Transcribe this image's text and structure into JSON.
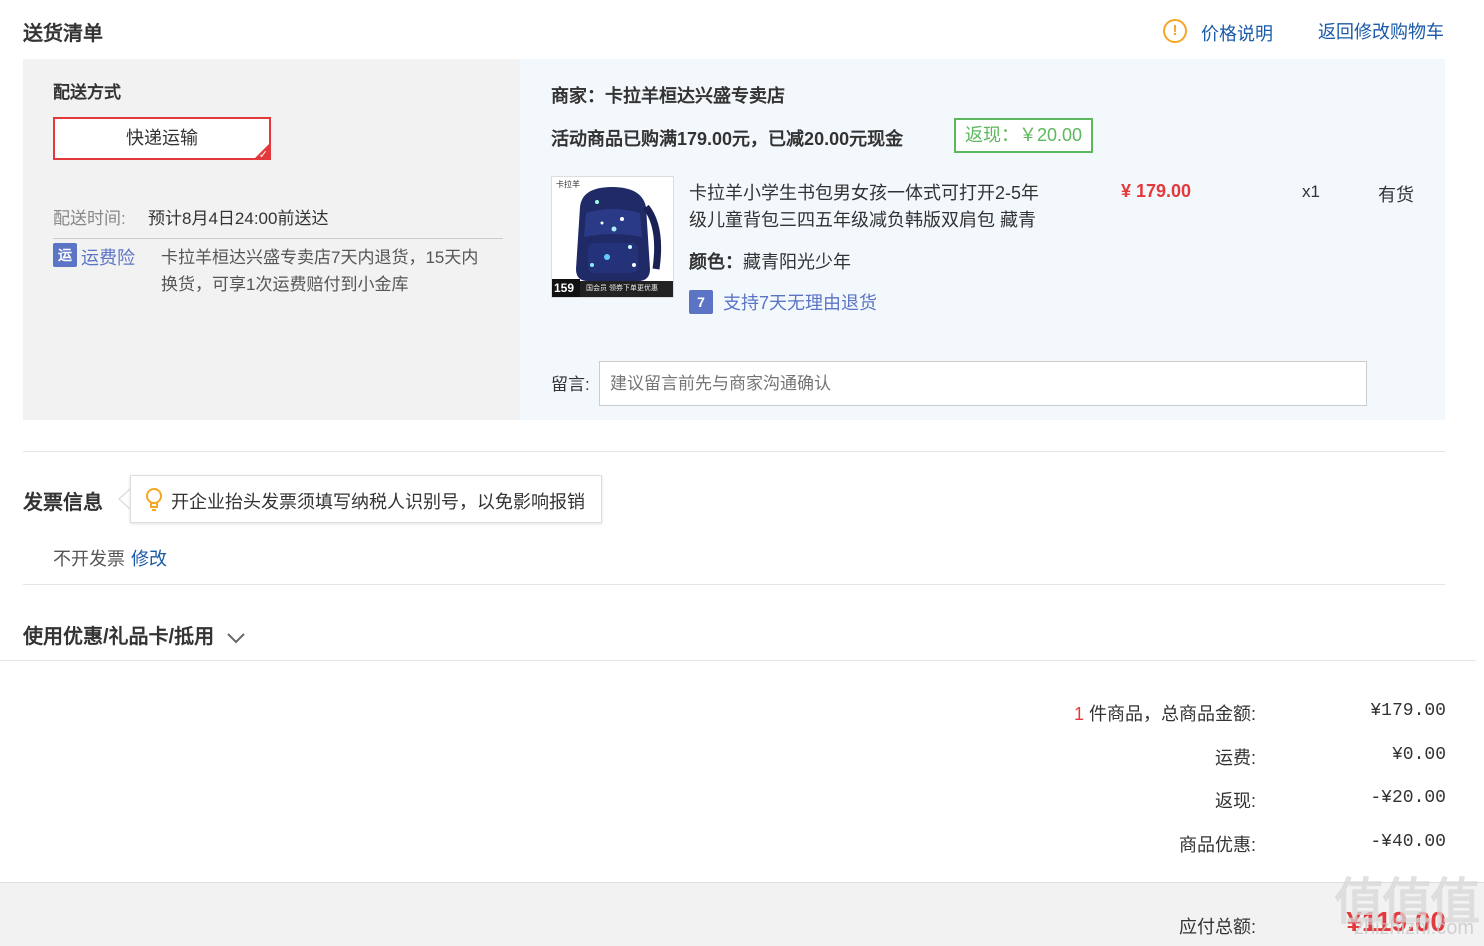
{
  "header": {
    "title": "送货清单",
    "price_note": "价格说明",
    "back_to_cart": "返回修改购物车"
  },
  "shipping": {
    "method_label": "配送方式",
    "method_value": "快递运输",
    "time_label": "配送时间:",
    "time_value": "预计8月4日24:00前送达",
    "insurance_icon": "运",
    "insurance_label": "运费险",
    "insurance_text_line1": "卡拉羊桓达兴盛专卖店7天内退货，15天内",
    "insurance_text_line2": "换货，可享1次运费赔付到小金库"
  },
  "store": {
    "merchant_label": "商家：",
    "merchant_name": "卡拉羊桓达兴盛专卖店",
    "promo_text": "活动商品已购满179.00元，已减20.00元现金",
    "rebate_text": "返现：￥20.00"
  },
  "product": {
    "image_brand": "卡拉羊",
    "image_price": "159",
    "image_banner": "国会员 领券下单更优惠",
    "name_line1": "卡拉羊小学生书包男女孩一体式可打开2-5年",
    "name_line2": "级儿童背包三四五年级减负韩版双肩包 藏青",
    "price": "¥ 179.00",
    "quantity": "x1",
    "stock": "有货",
    "color_label": "颜色：",
    "color_value": "藏青阳光少年",
    "return_icon": "7",
    "return_policy": "支持7天无理由退货"
  },
  "note": {
    "label": "留言:",
    "placeholder": "建议留言前先与商家沟通确认"
  },
  "invoice": {
    "title": "发票信息",
    "tip": "开企业抬头发票须填写纳税人识别号，以免影响报销",
    "status": "不开发票",
    "edit": "修改"
  },
  "coupon": {
    "title": "使用优惠/礼品卡/抵用"
  },
  "summary": {
    "count": "1",
    "goods_label": " 件商品，总商品金额:",
    "goods_value": "¥179.00",
    "freight_label": "运费:",
    "freight_value": "¥0.00",
    "rebate_label": "返现:",
    "rebate_value": "-¥20.00",
    "discount_label": "商品优惠:",
    "discount_value": "-¥40.00",
    "total_label": "应付总额:",
    "total_value": "¥119.00"
  },
  "watermark": {
    "text": "值值值",
    "sub": "zhizhizhi.com"
  },
  "colors": {
    "accent_red": "#e4393c",
    "link_blue": "#1a5aa8",
    "green": "#5cb85c",
    "icon_blue": "#5b74c6",
    "warning": "#f5a623"
  }
}
